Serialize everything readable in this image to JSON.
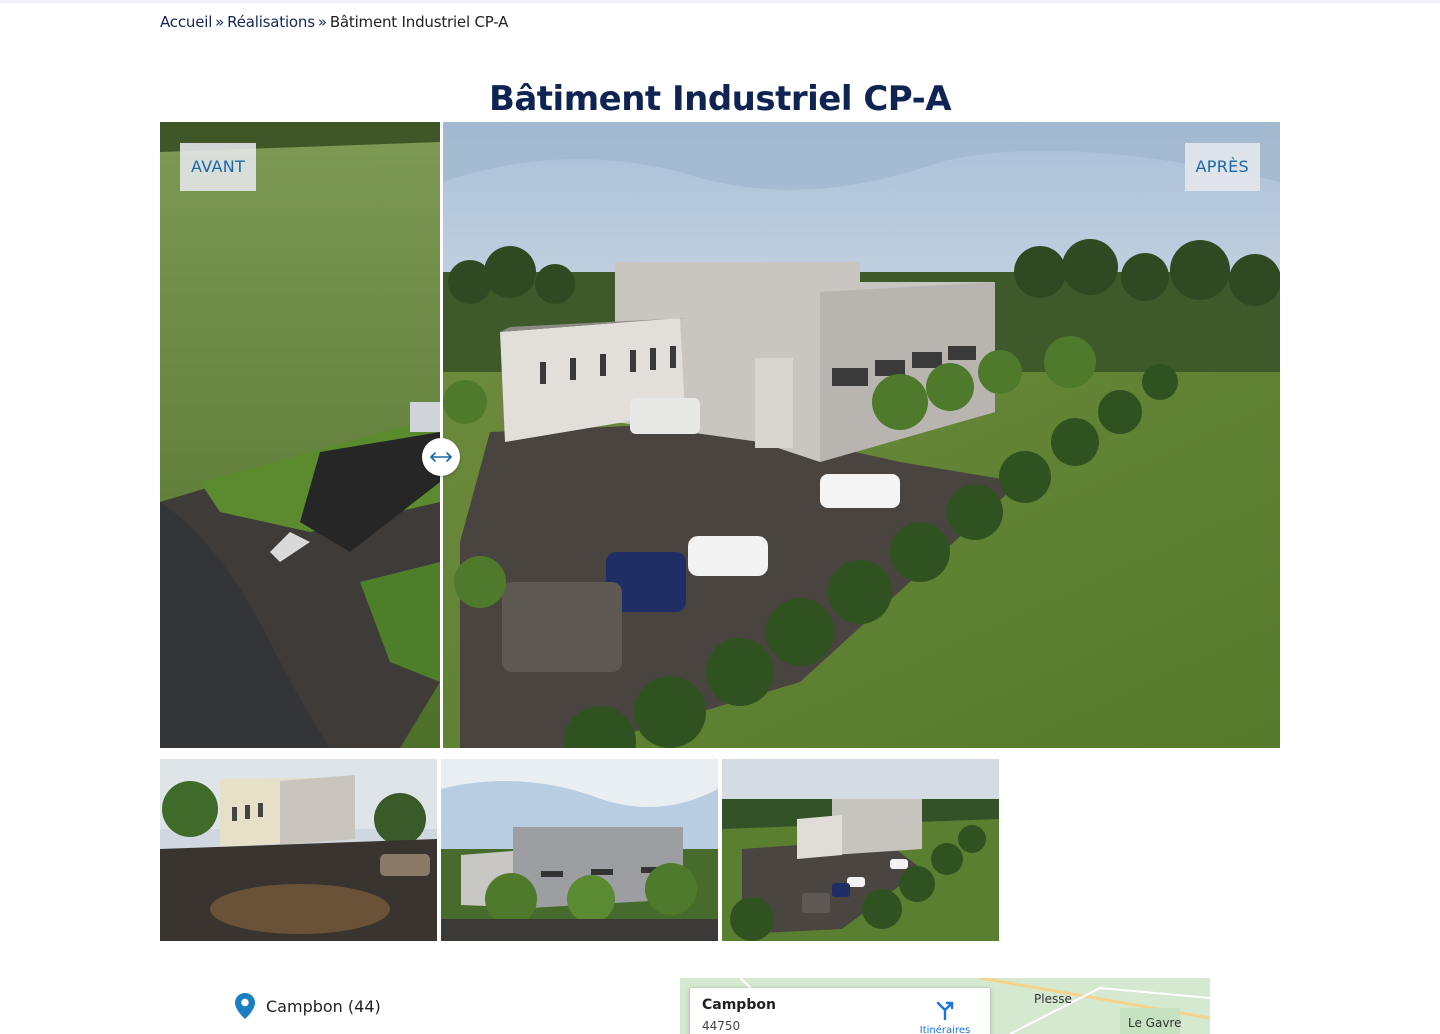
{
  "breadcrumb": {
    "home": "Accueil",
    "separator": "»",
    "section": "Réalisations",
    "current": "Bâtiment Industriel CP-A"
  },
  "page": {
    "title": "Bâtiment Industriel CP-A"
  },
  "comparison": {
    "before_label": "AVANT",
    "after_label": "APRÈS",
    "slider_position": 0.25,
    "handle_icon": "left-right-arrow-icon"
  },
  "thumbnails": [
    {
      "name": "thumbnail-1"
    },
    {
      "name": "thumbnail-2"
    },
    {
      "name": "thumbnail-3"
    }
  ],
  "location": {
    "icon": "map-pin-icon",
    "text": "Campbon (44)"
  },
  "map": {
    "place": "Campbon",
    "postal": "44750",
    "directions_label": "Itinéraires",
    "towns": [
      "Plesse",
      "Le Gavre"
    ]
  },
  "colors": {
    "title": "#0f2452",
    "badge_text": "#1a67a8",
    "pin": "#1a7fc4"
  }
}
